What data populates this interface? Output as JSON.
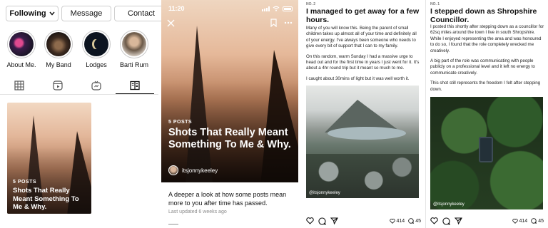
{
  "profile": {
    "buttons": {
      "following": "Following",
      "message": "Message",
      "contact": "Contact"
    },
    "highlights": [
      {
        "label": "About Me."
      },
      {
        "label": "My Band"
      },
      {
        "label": "Lodges"
      },
      {
        "label": "Barti Rum"
      }
    ],
    "tabs": [
      "grid-icon",
      "reels-icon",
      "igtv-icon",
      "guides-icon"
    ],
    "active_tab": "guides-icon",
    "guide_card": {
      "count": "5 POSTS",
      "title": "Shots That Really Meant Something To Me & Why."
    }
  },
  "guide": {
    "status_time": "11:20",
    "posts_count": "5 POSTS",
    "title": "Shots That Really Meant Something To Me & Why.",
    "author": "itsjonnykeeley",
    "description": "A deeper a look at how some posts mean more to you after time has passed.",
    "updated": "Last updated 6 weeks ago"
  },
  "post1": {
    "number": "NO. 2",
    "title": "I managed to get away for a few hours.",
    "paragraphs": [
      "Many of you will know this. Being the parent of small children takes up almost all of your time and definitely all of your energy. I've always been someone who needs to give every bit of support that I can to my family.",
      "On this random, warm Sunday I had a massive urge to head out and for the first time in years I just went for it. It's about a 4hr round trip but it meant so much to me.",
      "I caught about 30mins of light but it was well worth it."
    ],
    "watermark": "@itsjonnykeeley",
    "likes": "414",
    "comments": "45"
  },
  "post2": {
    "number": "NO. 1",
    "title": "I stepped down as Shropshire Councillor.",
    "paragraphs": [
      "I posted this shortly after stepping down as a councillor for 62sq miles around the town I live in south Shropshire. While I enjoyed representing the area and was honoured to do so, I found that the role completely wrecked me creatively.",
      "A big part of the role was communicating with people publicly on a professional level and it left no energy to communicate creatively.",
      "This shot still represents the freedom I felt after stepping down."
    ],
    "watermark": "@itsjonnykeeley",
    "likes": "414",
    "comments": "45"
  }
}
